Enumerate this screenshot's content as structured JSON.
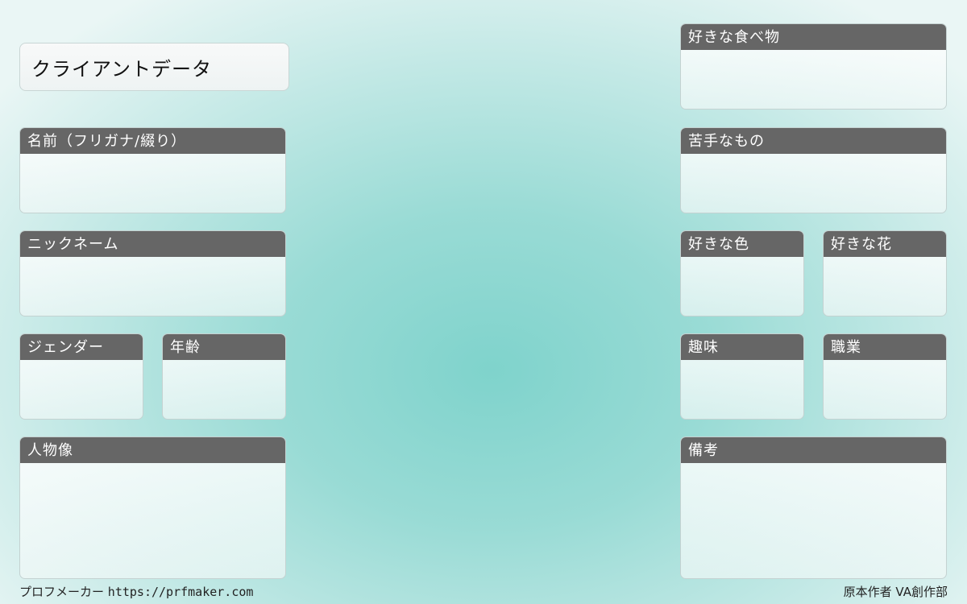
{
  "title": "クライアントデータ",
  "fields": {
    "name": "名前（フリガナ/綴り）",
    "nickname": "ニックネーム",
    "gender": "ジェンダー",
    "age": "年齢",
    "portrait": "人物像",
    "favorite_food": "好きな食べ物",
    "dislikes": "苦手なもの",
    "favorite_color": "好きな色",
    "favorite_flower": "好きな花",
    "hobby": "趣味",
    "occupation": "職業",
    "notes": "備考"
  },
  "footer": {
    "maker_label": "プロフメーカー",
    "maker_url": "https://prfmaker.com",
    "credit": "原本作者 VA創作部"
  },
  "colors": {
    "label_bg": "#666666",
    "label_text": "#ffffff",
    "bg_center": "#7fd3cc",
    "bg_edge": "#eaf6f5"
  }
}
